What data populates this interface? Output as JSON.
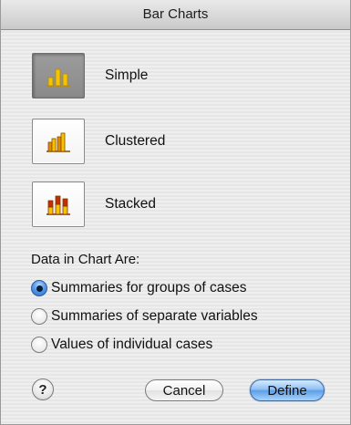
{
  "window": {
    "title": "Bar Charts"
  },
  "chart_types": [
    {
      "label": "Simple",
      "icon": "simple-bar-chart-icon",
      "selected": true
    },
    {
      "label": "Clustered",
      "icon": "clustered-bar-chart-icon",
      "selected": false
    },
    {
      "label": "Stacked",
      "icon": "stacked-bar-chart-icon",
      "selected": false
    }
  ],
  "data_section": {
    "label": "Data in Chart Are:",
    "options": [
      {
        "label": "Summaries for groups of cases",
        "checked": true
      },
      {
        "label": "Summaries of separate variables",
        "checked": false
      },
      {
        "label": "Values of individual cases",
        "checked": false
      }
    ]
  },
  "buttons": {
    "help_label": "?",
    "cancel_label": "Cancel",
    "define_label": "Define"
  },
  "colors": {
    "bar_yellow": "#f5c400",
    "bar_orange": "#e08a00",
    "bar_red": "#c03000",
    "define_blue": "#5e9fe6"
  }
}
